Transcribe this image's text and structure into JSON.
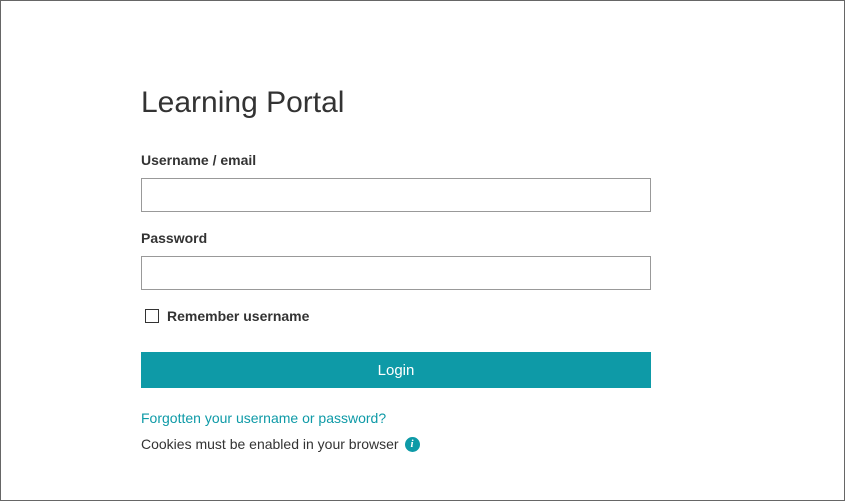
{
  "title": "Learning Portal",
  "form": {
    "username_label": "Username / email",
    "username_value": "",
    "password_label": "Password",
    "password_value": "",
    "remember_label": "Remember username",
    "login_button": "Login",
    "forgot_link": "Forgotten your username or password?",
    "cookies_text": "Cookies must be enabled in your browser"
  }
}
